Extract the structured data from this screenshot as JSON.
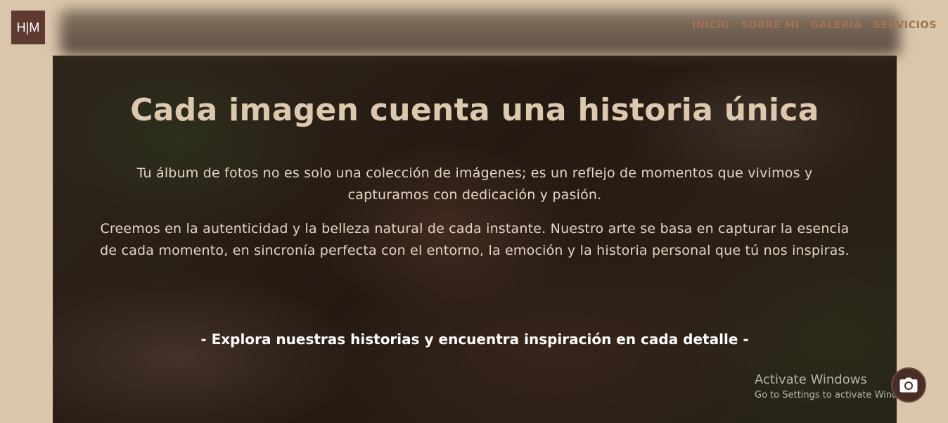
{
  "header": {
    "logo_text": "H|M",
    "nav": [
      {
        "label": "INICIO"
      },
      {
        "label": "SOBRE MI"
      },
      {
        "label": "GALERÍA"
      },
      {
        "label": "SERVICIOS"
      }
    ]
  },
  "hero": {
    "title": "Cada imagen cuenta una historia única",
    "paragraph1": "Tu álbum de fotos no es solo una colección de imágenes; es un reflejo de momentos que vivimos y capturamos con dedicación y pasión.",
    "paragraph2": "Creemos en la autenticidad y la belleza natural de cada instante. Nuestro arte se basa en capturar la esencia de cada momento, en sincronía perfecta con el entorno, la emoción y la historia personal que tú nos inspiras.",
    "tagline": "- Explora nuestras historias y encuentra inspiración en cada detalle -"
  },
  "watermark": {
    "title": "Activate Windows",
    "subtitle": "Go to Settings to activate Windows."
  },
  "icons": {
    "camera": "camera-icon"
  },
  "colors": {
    "background": "#d9c6ab",
    "logo_bg": "#5e3a31",
    "nav_text": "#a5714f",
    "title_text": "#dcc8ad"
  }
}
